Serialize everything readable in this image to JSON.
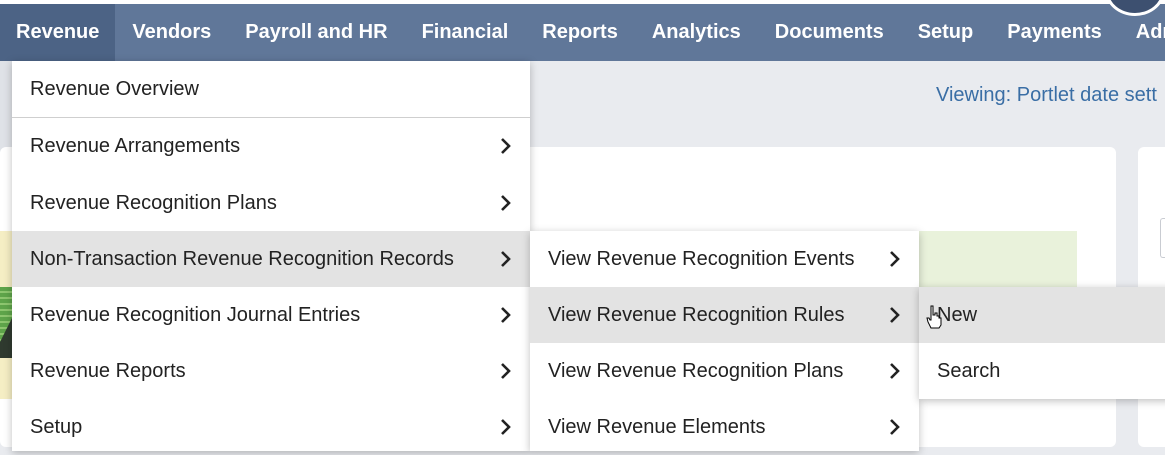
{
  "nav": {
    "items": [
      {
        "label": "Revenue",
        "active": true
      },
      {
        "label": "Vendors"
      },
      {
        "label": "Payroll and HR"
      },
      {
        "label": "Financial"
      },
      {
        "label": "Reports"
      },
      {
        "label": "Analytics"
      },
      {
        "label": "Documents"
      },
      {
        "label": "Setup"
      },
      {
        "label": "Payments"
      },
      {
        "label": "Adı"
      }
    ]
  },
  "viewing_text": "Viewing: Portlet date sett",
  "menu": {
    "level1": [
      {
        "label": "Revenue Overview"
      },
      {
        "label": "Revenue Arrangements",
        "submenu": true
      },
      {
        "label": "Revenue Recognition Plans",
        "submenu": true
      },
      {
        "label": "Non-Transaction Revenue Recognition Records",
        "submenu": true,
        "highlighted": true
      },
      {
        "label": "Revenue Recognition Journal Entries",
        "submenu": true
      },
      {
        "label": "Revenue Reports",
        "submenu": true
      },
      {
        "label": "Setup",
        "submenu": true
      }
    ],
    "level2": [
      {
        "label": "View Revenue Recognition Events",
        "submenu": true
      },
      {
        "label": "View Revenue Recognition Rules",
        "submenu": true,
        "highlighted": true
      },
      {
        "label": "View Revenue Recognition Plans",
        "submenu": true
      },
      {
        "label": "View Revenue Elements",
        "submenu": true
      }
    ],
    "level3": [
      {
        "label": "New",
        "highlighted": true
      },
      {
        "label": "Search"
      }
    ]
  },
  "icons": {
    "submenu": "chevron-right-icon",
    "cursor": "hand-pointer-icon"
  },
  "colors": {
    "navbar": "#607799",
    "nav_active": "#4c6385",
    "highlight": "#e3e3e3",
    "link": "#3a6ea5"
  }
}
